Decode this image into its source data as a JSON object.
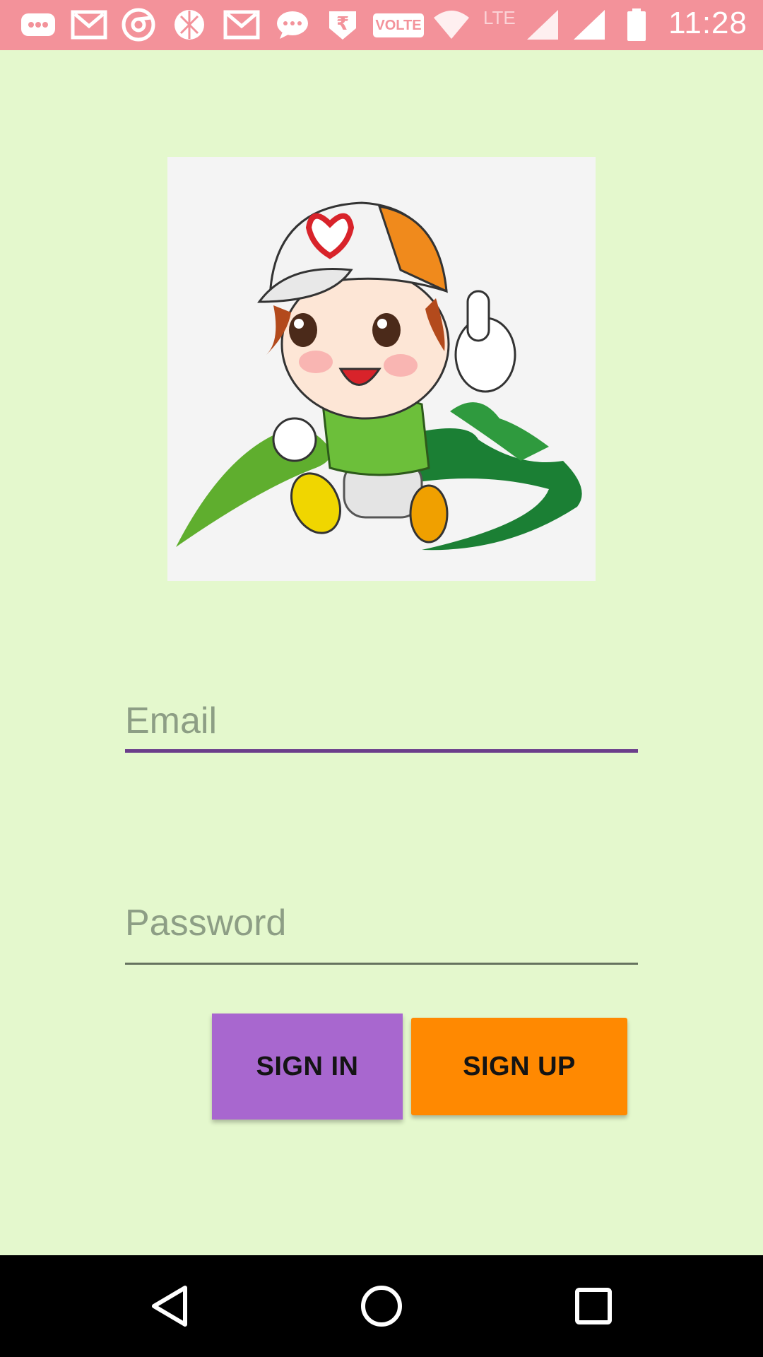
{
  "status_bar": {
    "time": "11:28",
    "volte_label": "VOLTE",
    "lte_label": "LTE",
    "icons": [
      "message-icon",
      "gmail-icon",
      "chrome-icon",
      "aperture-icon",
      "gmail-icon",
      "chat-bubble-icon",
      "rupee-icon",
      "volte-icon",
      "wifi-icon",
      "lte-icon",
      "signal-icon",
      "signal-icon",
      "battery-icon"
    ]
  },
  "logo": {
    "description_icon": "mascot-thumbs-up-logo"
  },
  "form": {
    "email_placeholder": "Email",
    "email_value": "",
    "password_placeholder": "Password",
    "password_value": ""
  },
  "buttons": {
    "signin_label": "SIGN IN",
    "signup_label": "SIGN UP"
  },
  "nav_bar": {
    "icons": [
      "back-icon",
      "home-icon",
      "recents-icon"
    ]
  },
  "colors": {
    "background": "#e4f8cd",
    "status_bar": "#f3929a",
    "signin_button": "#a867cf",
    "signup_button": "#ff8901",
    "email_underline": "#6b3e8b"
  }
}
